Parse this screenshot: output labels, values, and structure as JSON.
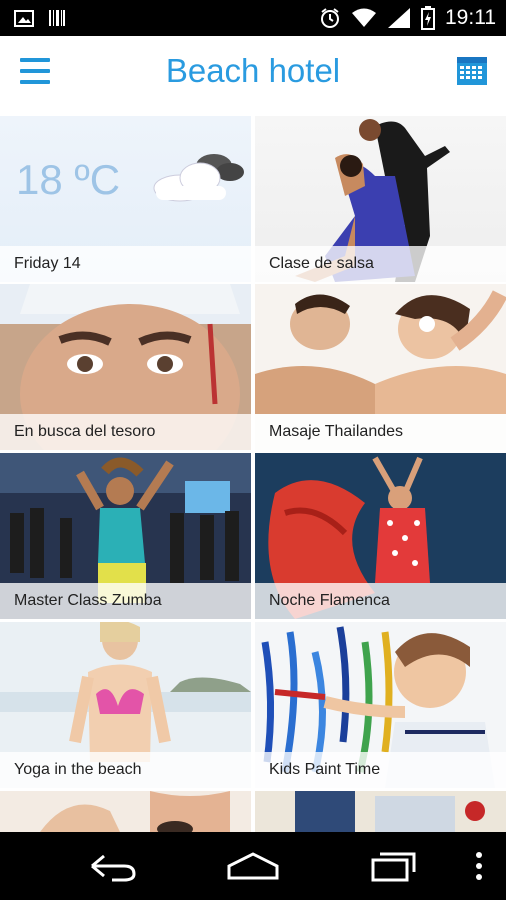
{
  "status_bar": {
    "time": "19:11",
    "icons": [
      "image-icon",
      "barcode-icon",
      "alarm-icon",
      "wifi-icon",
      "signal-icon",
      "battery-icon"
    ]
  },
  "app_bar": {
    "title": "Beach hotel",
    "accent_color": "#2a9be0"
  },
  "weather": {
    "temperature": "18 ºC",
    "day": "Friday 14",
    "icon": "cloud-icon"
  },
  "activities": [
    {
      "label": "Clase de salsa",
      "image": "salsa-dancers-image"
    },
    {
      "label": "En busca del tesoro",
      "image": "boy-face-image"
    },
    {
      "label": "Masaje Thailandes",
      "image": "couple-massage-image"
    },
    {
      "label": "Master Class Zumba",
      "image": "zumba-class-image"
    },
    {
      "label": "Noche Flamenca",
      "image": "flamenco-dancer-image"
    },
    {
      "label": "Yoga in the beach",
      "image": "yoga-beach-image"
    },
    {
      "label": "Kids Paint Time",
      "image": "kid-painting-image"
    }
  ],
  "nav_bar": {
    "icons": [
      "back-icon",
      "home-icon",
      "recents-icon",
      "overflow-menu-icon"
    ]
  }
}
